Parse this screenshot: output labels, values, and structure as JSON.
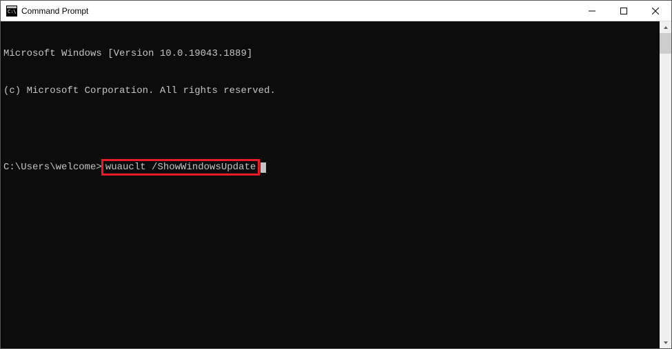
{
  "window": {
    "title": "Command Prompt"
  },
  "terminal": {
    "line1": "Microsoft Windows [Version 10.0.19043.1889]",
    "line2": "(c) Microsoft Corporation. All rights reserved.",
    "prompt": "C:\\Users\\welcome>",
    "command": "wuauclt /ShowWindowsUpdate"
  },
  "highlight": {
    "color": "#ed1c24"
  }
}
